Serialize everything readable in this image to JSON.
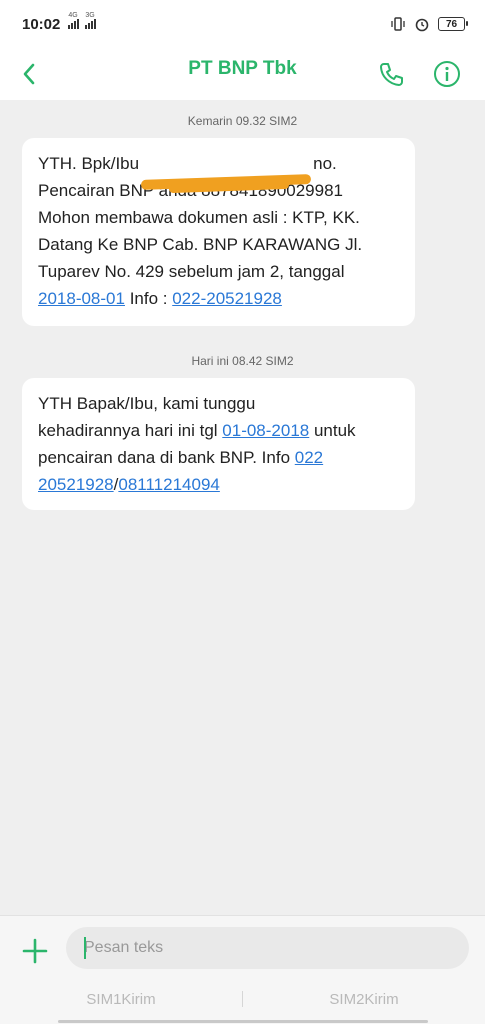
{
  "status_bar": {
    "time": "10:02",
    "network_1": "4G",
    "network_2": "3G",
    "battery": "76"
  },
  "header": {
    "title": "PT BNP Tbk"
  },
  "messages": [
    {
      "timestamp": "Kemarin 09.32  SIM2",
      "line1_start": "YTH. Bpk/Ibu",
      "line1_end": "no.",
      "line2": "Pencairan BNP anda 887841890029981",
      "line3": "Mohon membawa dokumen asli : KTP, KK.",
      "line4": "Datang Ke BNP Cab. BNP KARAWANG Jl.",
      "line5": "Tuparev No. 429 sebelum jam 2, tanggal",
      "date_link": "2018-08-01",
      "info_text": " Info : ",
      "phone_link": "022-20521928"
    },
    {
      "timestamp": "Hari ini 08.42  SIM2",
      "line1": "YTH Bapak/Ibu, kami tunggu",
      "line2_start": "kehadirannya hari ini tgl ",
      "date_link": "01-08-2018",
      "line2_end": " untuk",
      "line3_start": "pencairan dana di bank BNP. Info ",
      "phone_link_part1": "022",
      "phone_link_part2": "20521928",
      "separator": "/",
      "phone_link_2": "08111214094"
    }
  ],
  "composer": {
    "placeholder": "Pesan teks",
    "sim1_label": "SIM1Kirim",
    "sim2_label": "SIM2Kirim"
  },
  "colors": {
    "accent": "#2bb56b",
    "link": "#2a78d6",
    "redaction": "#f0a020"
  }
}
